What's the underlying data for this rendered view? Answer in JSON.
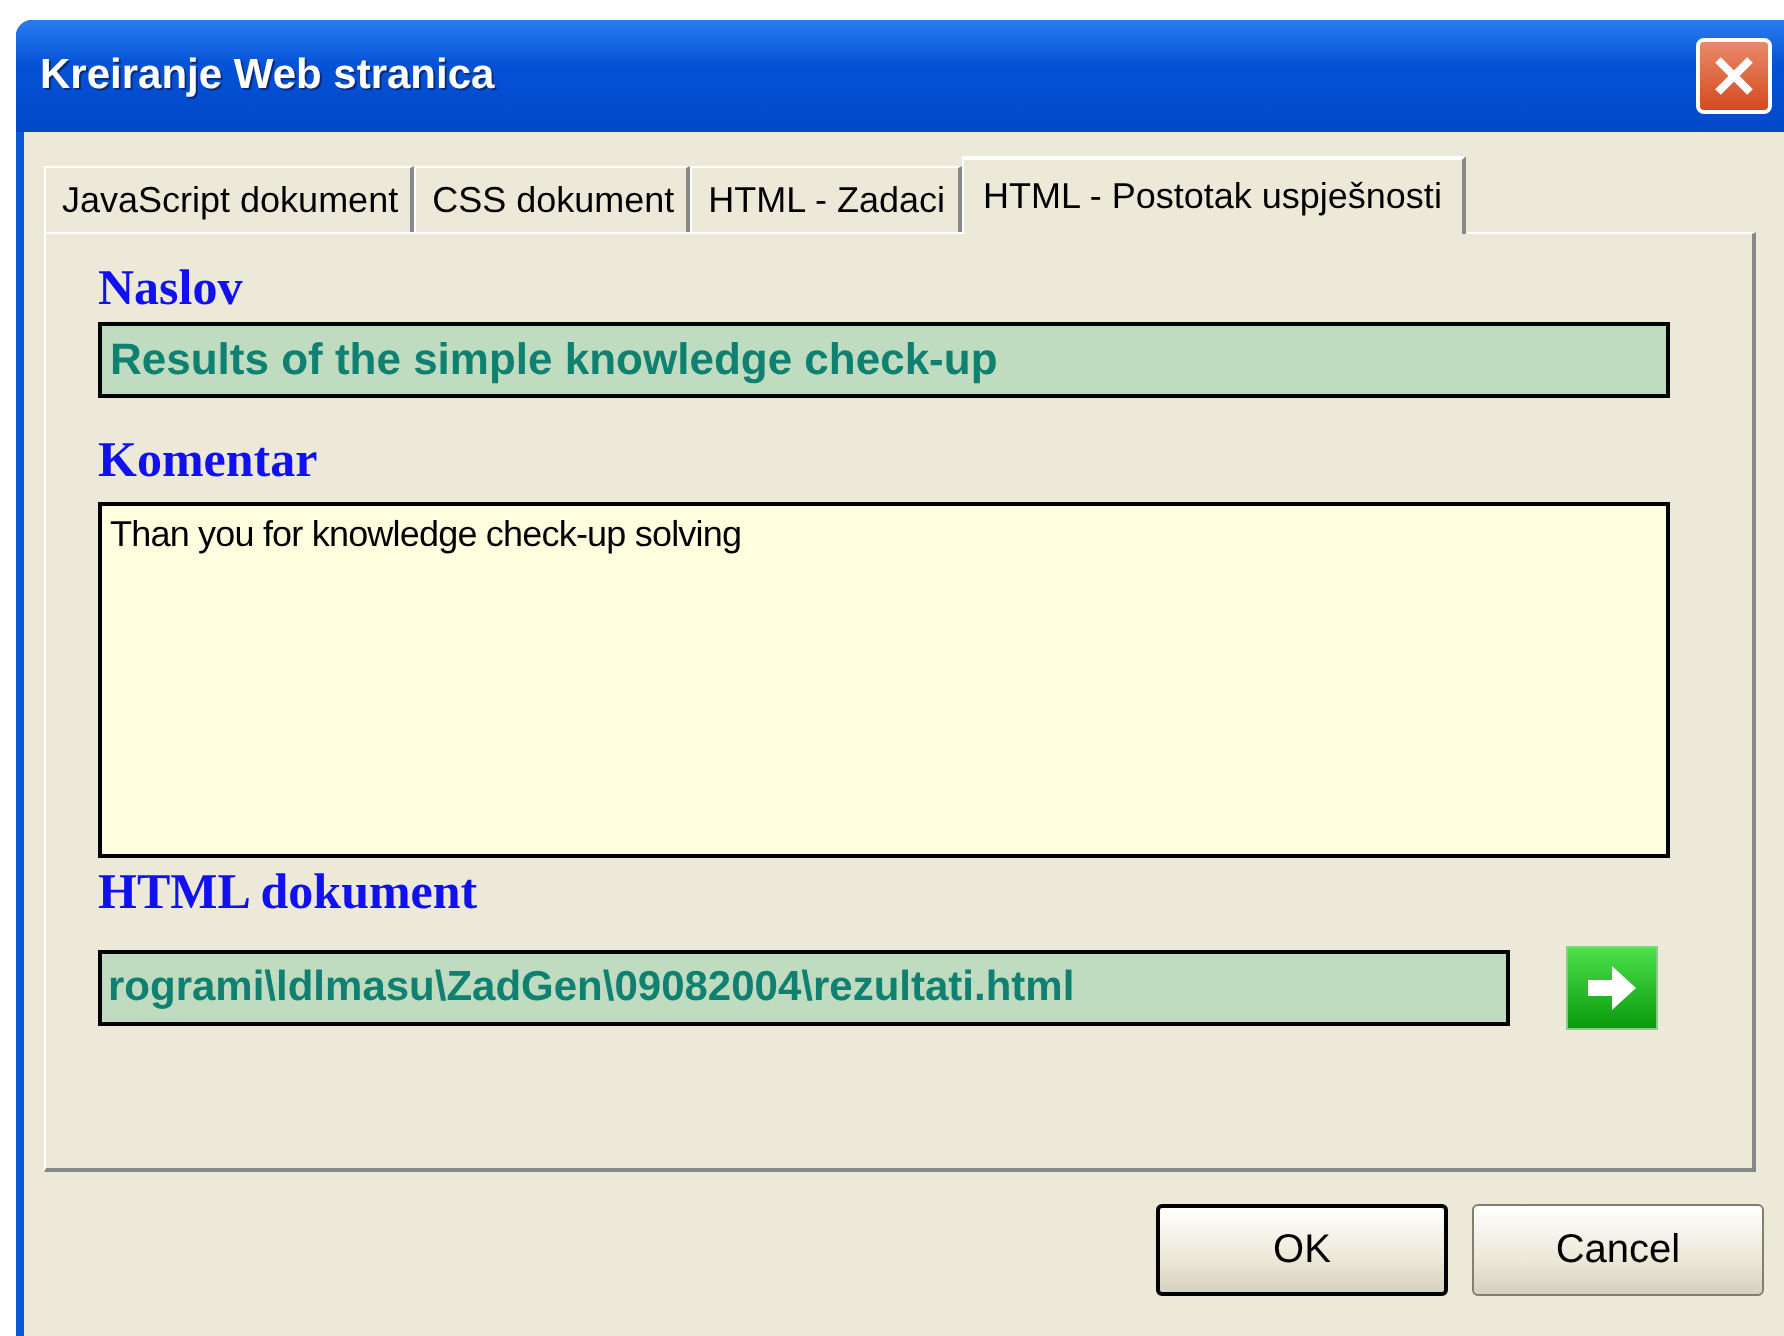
{
  "window": {
    "title": "Kreiranje Web stranica"
  },
  "tabs": [
    {
      "label": "JavaScript dokument",
      "selected": false
    },
    {
      "label": "CSS dokument",
      "selected": false
    },
    {
      "label": "HTML - Zadaci",
      "selected": false
    },
    {
      "label": "HTML - Postotak uspješnosti",
      "selected": true
    }
  ],
  "title_field": {
    "label": "Naslov",
    "value": "Results of the simple knowledge check-up"
  },
  "comment_field": {
    "label": "Komentar",
    "value": "Than you for knowledge check-up solving"
  },
  "document_field": {
    "label": "HTML dokument",
    "value": "rogrami\\ldlmasu\\ZadGen\\09082004\\rezultati.html"
  },
  "buttons": [
    "OK",
    "Cancel"
  ]
}
